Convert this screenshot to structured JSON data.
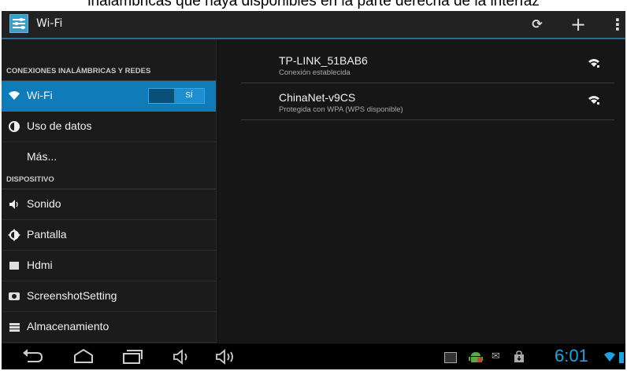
{
  "caption": "inalámbricas que haya disponibles en la parte derecha de la interfaz",
  "action_bar": {
    "title": "Wi-Fi",
    "icons": [
      "settings-app-icon",
      "wps-icon",
      "add-icon",
      "overflow-menu-icon"
    ]
  },
  "sidebar": {
    "section_wireless": "CONEXIONES INALÁMBRICAS Y REDES",
    "section_device": "DISPOSITIVO",
    "wifi": {
      "label": "Wi-Fi",
      "toggle": "SÍ"
    },
    "items": [
      {
        "label": "Uso de datos",
        "icon": "data-usage-icon"
      },
      {
        "label": "Más...",
        "icon": ""
      },
      {
        "label": "Sonido",
        "icon": "sound-icon"
      },
      {
        "label": "Pantalla",
        "icon": "display-icon"
      },
      {
        "label": "Hdmi",
        "icon": "hdmi-icon"
      },
      {
        "label": "ScreenshotSetting",
        "icon": "camera-icon"
      },
      {
        "label": "Almacenamiento",
        "icon": "storage-icon"
      }
    ]
  },
  "networks": [
    {
      "ssid": "TP-LINK_51BAB6",
      "status": "Conexión establecida"
    },
    {
      "ssid": "ChinaNet-v9CS",
      "status": "Protegida con WPA (WPS disponible)"
    }
  ],
  "status_bar": {
    "time": "6:01"
  },
  "colors": {
    "accent": "#0f7bb8",
    "clock": "#1fa3e0",
    "background": "#161616"
  }
}
